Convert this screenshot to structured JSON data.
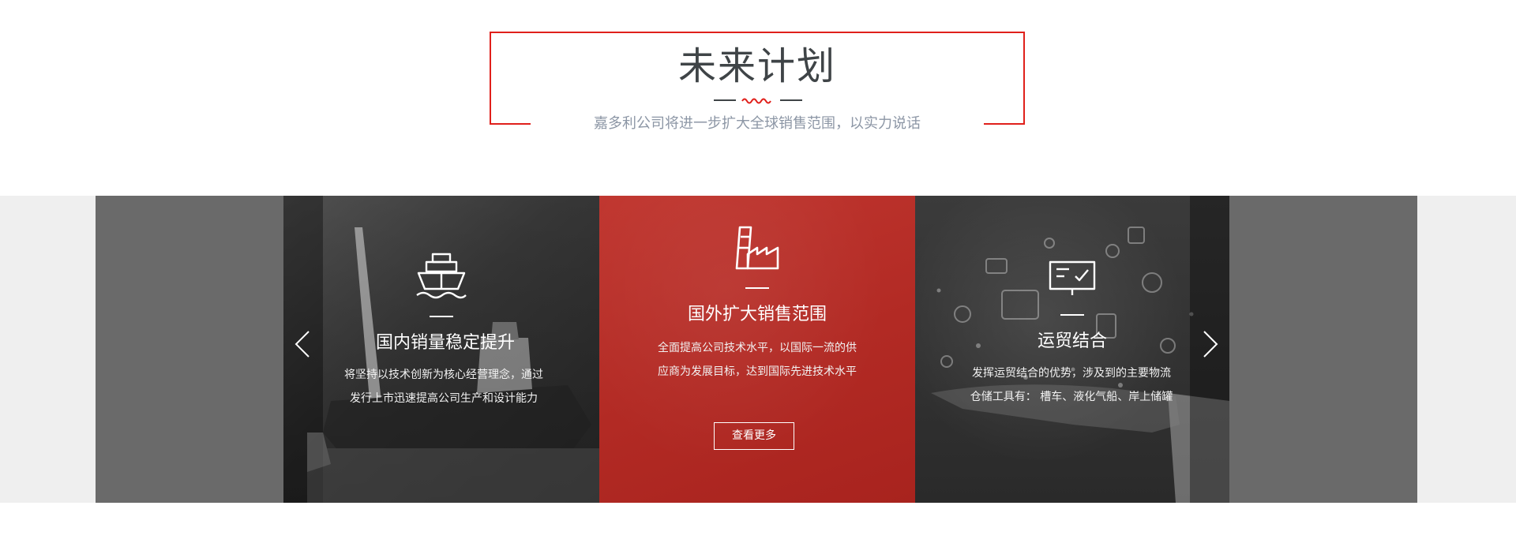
{
  "header": {
    "title": "未来计划",
    "subtitle": "嘉多利公司将进一步扩大全球销售范围，以实力说话"
  },
  "colors": {
    "accent_red": "#e0201b",
    "card_red": "#b52b25",
    "band_grey": "#6a6a6a"
  },
  "slider": {
    "prev_icon": "chevron-left-icon",
    "next_icon": "chevron-right-icon",
    "cards": [
      {
        "icon": "ship-icon",
        "title": "国内销量稳定提升",
        "description": "将坚持以技术创新为核心经营理念，通过发行上市迅速提高公司生产和设计能力"
      },
      {
        "icon": "factory-icon",
        "title": "国外扩大销售范围",
        "description": "全面提高公司技术水平，以国际一流的供应商为发展目标，达到国际先进技术水平",
        "button_label": "查看更多"
      },
      {
        "icon": "monitor-check-icon",
        "title": "运贸结合",
        "description": "发挥运贸结合的优势，涉及到的主要物流仓储工具有： 槽车、液化气船、岸上储罐"
      }
    ]
  }
}
